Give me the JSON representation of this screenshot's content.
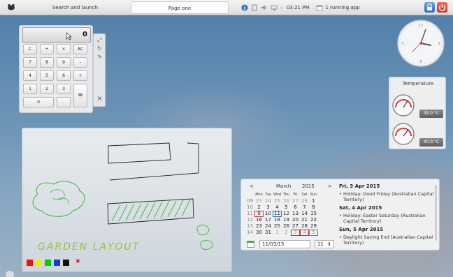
{
  "panel": {
    "launcher_label": "Search and launch",
    "pager_label": "Page one",
    "clock": "03:21 PM",
    "running": "1 running app"
  },
  "calculator": {
    "display": "0",
    "buttons": [
      "C",
      "÷",
      "×",
      "AC",
      "7",
      "8",
      "9",
      "-",
      "4",
      "5",
      "6",
      "+",
      "1",
      "2",
      "3",
      "=",
      "0",
      "."
    ]
  },
  "temperature": {
    "title": "Temperature",
    "sensor1": "39.0 °C",
    "sensor2": "40.0 °C"
  },
  "whiteboard": {
    "handwriting": "GARDEN LAYOUT",
    "swatches": [
      "#e11",
      "#ee0",
      "#0c0",
      "#1a3ad8",
      "#111"
    ]
  },
  "calendar": {
    "prev": "<",
    "next": ">",
    "month": "March",
    "year": "2015",
    "dow": [
      "Mon",
      "Tue",
      "Wed",
      "Thu",
      "Fri",
      "Sat",
      "Sun"
    ],
    "weeks": [
      {
        "no": "09",
        "days": [
          "23",
          "24",
          "25",
          "26",
          "27",
          "28",
          "1"
        ]
      },
      {
        "no": "10",
        "days": [
          "2",
          "3",
          "4",
          "5",
          "6",
          "7",
          "8"
        ]
      },
      {
        "no": "11",
        "days": [
          "9",
          "10",
          "11",
          "12",
          "13",
          "14",
          "15"
        ]
      },
      {
        "no": "12",
        "days": [
          "16",
          "17",
          "18",
          "19",
          "20",
          "21",
          "22"
        ]
      },
      {
        "no": "13",
        "days": [
          "23",
          "24",
          "25",
          "26",
          "27",
          "28",
          "29"
        ]
      },
      {
        "no": "14",
        "days": [
          "30",
          "31",
          "1",
          "2",
          "3",
          "4",
          "5"
        ]
      }
    ],
    "date_input": "11/03/15",
    "spin_value": "11",
    "events": [
      {
        "day": "Fri, 3 Apr 2015",
        "items": [
          "Holiday: Good Friday (Australian Capital Territory)"
        ]
      },
      {
        "day": "Sat, 4 Apr 2015",
        "items": [
          "Holiday: Easter Saturday (Australian Capital Territory)"
        ]
      },
      {
        "day": "Sun, 5 Apr 2015",
        "items": [
          "Daylight Saving End (Australian Capital Territory)"
        ]
      }
    ]
  }
}
